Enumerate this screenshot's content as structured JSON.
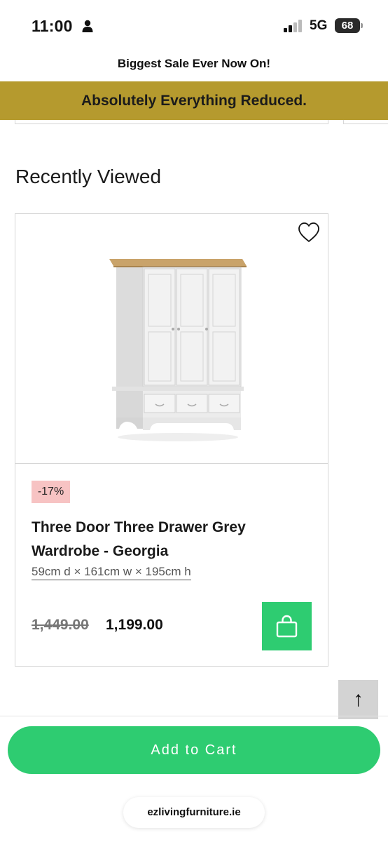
{
  "status_bar": {
    "time": "11:00",
    "network": "5G",
    "battery": "68",
    "icons": [
      "person-icon",
      "signal-icon"
    ]
  },
  "promo": {
    "top_text": "Biggest Sale Ever Now On!",
    "banner_text": "Absolutely Everything Reduced.",
    "banner_color": "#b59a2e"
  },
  "section": {
    "title": "Recently Viewed"
  },
  "product": {
    "discount": "-17%",
    "title": "Three Door Three Drawer Grey Wardrobe - Georgia",
    "dimensions": "59cm d × 161cm w × 195cm h",
    "old_price": "1,449.00",
    "new_price": "1,199.00",
    "wishlist_icon": "heart-outline-icon",
    "cart_icon": "shopping-bag-icon",
    "image": "grey-three-door-wardrobe",
    "discount_color": "#f7c3c3"
  },
  "scroll_top": {
    "icon": "arrow-up-icon",
    "label": "↑"
  },
  "footer": {
    "add_to_cart_label": "Add to Cart",
    "url": "ezlivingfurniture.ie",
    "accent_color": "#2ecc71"
  }
}
